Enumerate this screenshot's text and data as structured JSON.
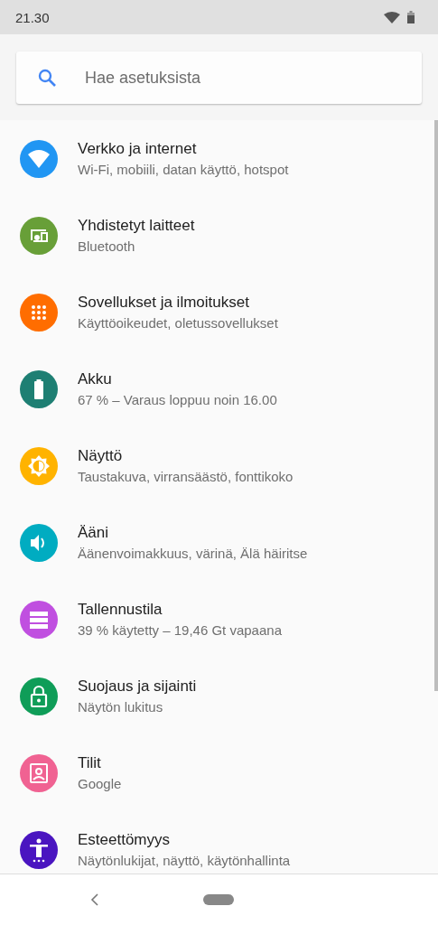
{
  "status_bar": {
    "time": "21.30"
  },
  "search": {
    "placeholder": "Hae asetuksista"
  },
  "items": [
    {
      "title": "Verkko ja internet",
      "subtitle": "Wi-Fi, mobiili, datan käyttö, hotspot",
      "color": "#2196f3"
    },
    {
      "title": "Yhdistetyt laitteet",
      "subtitle": "Bluetooth",
      "color": "#689f38"
    },
    {
      "title": "Sovellukset ja ilmoitukset",
      "subtitle": "Käyttöoikeudet, oletussovellukset",
      "color": "#ff6d00"
    },
    {
      "title": "Akku",
      "subtitle": "67 % – Varaus loppuu noin 16.00",
      "color": "#1e7f73"
    },
    {
      "title": "Näyttö",
      "subtitle": "Taustakuva, virransäästö, fonttikoko",
      "color": "#ffb300"
    },
    {
      "title": "Ääni",
      "subtitle": "Äänenvoimakkuus, värinä, Älä häiritse",
      "color": "#00acc1"
    },
    {
      "title": "Tallennustila",
      "subtitle": "39 % käytetty – 19,46 Gt vapaana",
      "color": "#c04fe0"
    },
    {
      "title": "Suojaus ja sijainti",
      "subtitle": "Näytön lukitus",
      "color": "#0f9d58"
    },
    {
      "title": "Tilit",
      "subtitle": "Google",
      "color": "#f06292"
    },
    {
      "title": "Esteettömyys",
      "subtitle": "Näytönlukijat, näyttö, käytönhallinta",
      "color": "#4a15c0"
    }
  ]
}
